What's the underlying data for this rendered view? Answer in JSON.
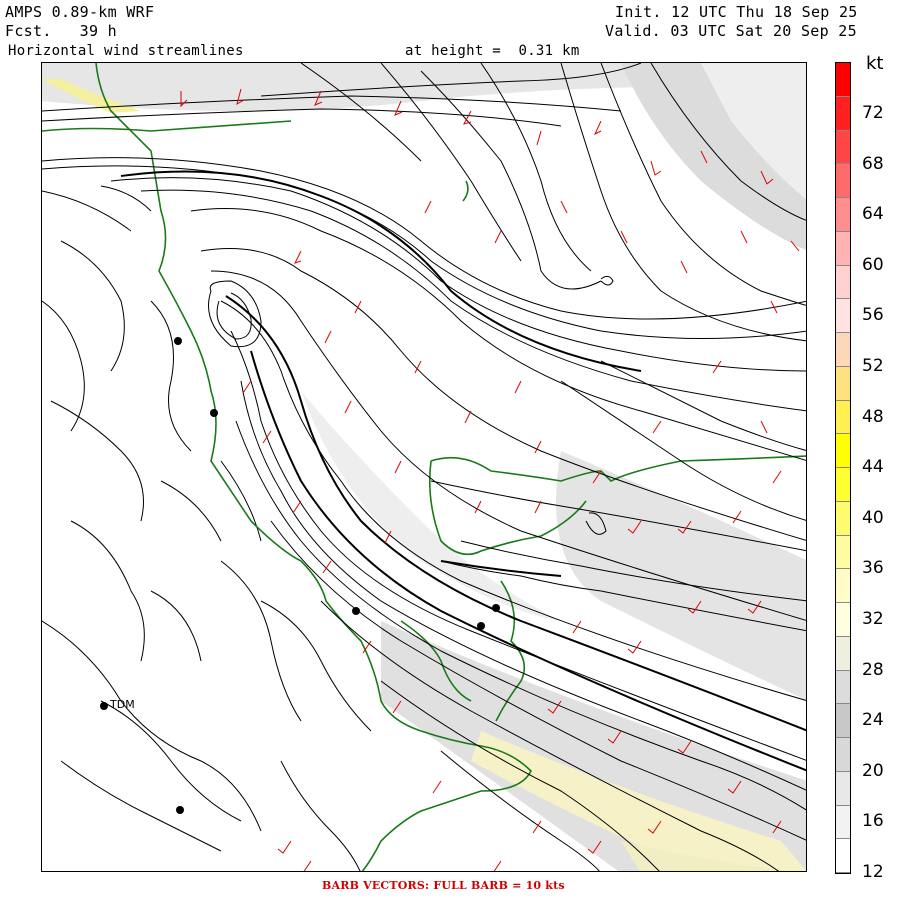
{
  "header": {
    "model": "AMPS 0.89-km WRF",
    "forecast": "Fcst.   39 h",
    "field": "Horizontal wind streamlines",
    "height": "at height =  0.31 km",
    "init": "Init. 12 UTC Thu 18 Sep 25",
    "valid": "Valid. 03 UTC Sat 20 Sep 25"
  },
  "scale": {
    "unit": "kt",
    "ticks": [
      "72",
      "68",
      "64",
      "60",
      "56",
      "52",
      "48",
      "44",
      "40",
      "36",
      "32",
      "28",
      "24",
      "20",
      "16",
      "12"
    ],
    "colors": [
      "#ff0000",
      "#ff2020",
      "#ff4545",
      "#ff6a6a",
      "#ff8f8f",
      "#ffb3b3",
      "#ffd0d0",
      "#ffe2e2",
      "#fdd8b8",
      "#ffe080",
      "#ffef50",
      "#ffff00",
      "#ffff30",
      "#fffb70",
      "#fffba0",
      "#fffcc8",
      "#ffffe0",
      "#efefdf",
      "#dcdcdc",
      "#c8c8c8",
      "#d8d8d8",
      "#e8e8e8",
      "#f2f2f2",
      "#ffffff"
    ]
  },
  "stations": [
    {
      "label": "TDM"
    }
  ],
  "footer": "BARB VECTORS:  FULL BARB = 10 kts"
}
